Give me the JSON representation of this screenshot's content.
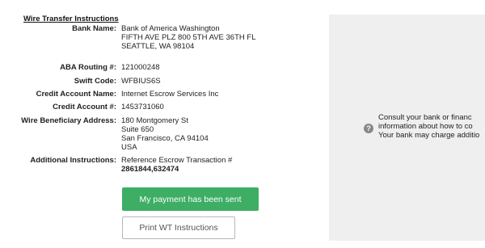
{
  "heading": "Wire Transfer Instructions",
  "fields": {
    "bank_name": {
      "label": "Bank Name:",
      "lines": [
        "Bank of America Washington",
        "FIFTH AVE PLZ 800 5TH AVE 36TH FL",
        "SEATTLE, WA 98104"
      ]
    },
    "aba_routing": {
      "label": "ABA Routing #:",
      "value": "121000248"
    },
    "swift_code": {
      "label": "Swift Code:",
      "value": "WFBIUS6S"
    },
    "credit_account_name": {
      "label": "Credit Account Name:",
      "value": "Internet Escrow Services Inc"
    },
    "credit_account_number": {
      "label": "Credit Account #:",
      "value": "1453731060"
    },
    "beneficiary_address": {
      "label": "Wire Beneficiary Address:",
      "lines": [
        "180 Montgomery St",
        "Suite 650",
        "San Francisco, CA 94104",
        "USA"
      ]
    },
    "additional_instructions": {
      "label": "Additional Instructions:",
      "line1": "Reference Escrow Transaction #",
      "line2": "2861844,632474"
    }
  },
  "buttons": {
    "sent": "My payment has been sent",
    "print": "Print WT Instructions"
  },
  "help_panel": {
    "icon": "question-icon",
    "icon_glyph": "?",
    "lines": [
      "Consult your bank or financ",
      "information about how to co",
      "Your bank may charge additio"
    ]
  },
  "colors": {
    "primary_button": "#3dae63",
    "panel_bg": "#efefef"
  }
}
